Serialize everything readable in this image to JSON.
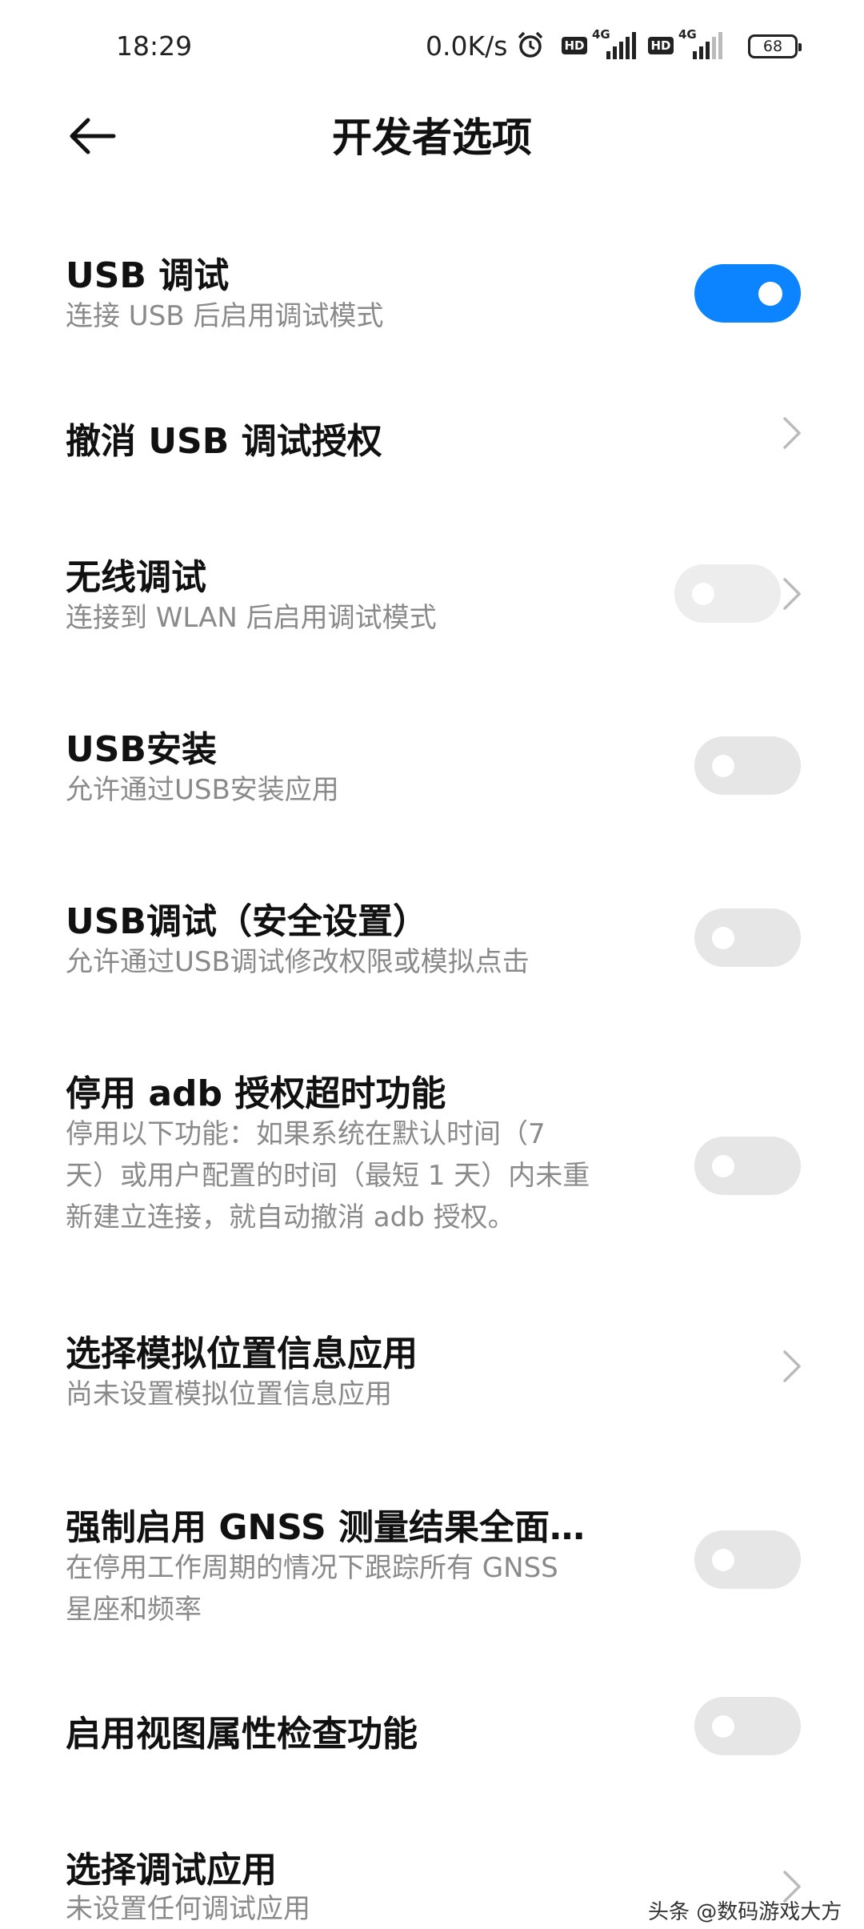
{
  "status_bar": {
    "time": "18:29",
    "net_speed": "0.0K/s",
    "hd_badge": "HD",
    "signal_label": "4G",
    "battery": "68"
  },
  "header": {
    "title": "开发者选项",
    "back_icon": "arrow-left-icon"
  },
  "items": [
    {
      "title": "USB 调试",
      "subtitle": "连接 USB 后启用调试模式",
      "control": "toggle",
      "enabled": true
    },
    {
      "title": "撤消 USB 调试授权",
      "subtitle": "",
      "control": "chevron"
    },
    {
      "title": "无线调试",
      "subtitle": "连接到 WLAN 后启用调试模式",
      "control": "toggle+chevron",
      "enabled": false
    },
    {
      "title": "USB安装",
      "subtitle": "允许通过USB安装应用",
      "control": "toggle",
      "enabled": false
    },
    {
      "title": "USB调试（安全设置）",
      "subtitle": "允许通过USB调试修改权限或模拟点击",
      "control": "toggle",
      "enabled": false
    },
    {
      "title": "停用 adb 授权超时功能",
      "subtitle_lines": [
        "停用以下功能：如果系统在默认时间（7",
        "天）或用户配置的时间（最短 1 天）内未重",
        "新建立连接，就自动撤消 adb 授权。"
      ],
      "control": "toggle",
      "enabled": false
    },
    {
      "title": "选择模拟位置信息应用",
      "subtitle": "尚未设置模拟位置信息应用",
      "control": "chevron"
    },
    {
      "title": "强制启用 GNSS 测量结果全面…",
      "subtitle_lines": [
        "在停用工作周期的情况下跟踪所有 GNSS",
        "星座和频率"
      ],
      "control": "toggle",
      "enabled": false
    },
    {
      "title": "启用视图属性检查功能",
      "subtitle": "",
      "control": "toggle",
      "enabled": false
    },
    {
      "title": "选择调试应用",
      "subtitle": "未设置任何调试应用",
      "control": "chevron"
    }
  ],
  "watermark": "头条 @数码游戏大方",
  "colors": {
    "accent": "#0d84ff",
    "toggle_off": "#e6e6e6",
    "subtitle": "#8a8a8a"
  }
}
